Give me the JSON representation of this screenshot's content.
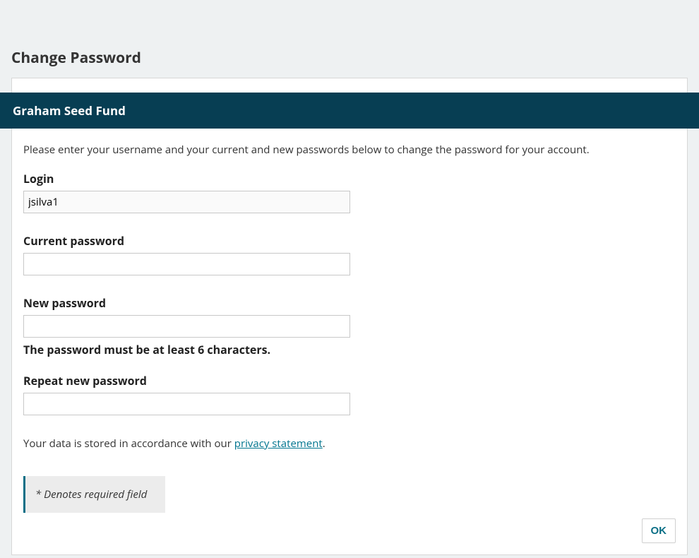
{
  "page": {
    "title": "Change Password"
  },
  "card": {
    "header": "Graham Seed Fund",
    "instructions": "Please enter your username and your current and new passwords below to change the password for your account."
  },
  "form": {
    "login": {
      "label": "Login",
      "value": "jsilva1"
    },
    "current_password": {
      "label": "Current password",
      "value": ""
    },
    "new_password": {
      "label": "New password",
      "value": "",
      "hint": "The password must be at least 6 characters."
    },
    "repeat_password": {
      "label": "Repeat new password",
      "value": ""
    }
  },
  "privacy": {
    "prefix": "Your data is stored in accordance with our ",
    "link_text": "privacy statement",
    "suffix": "."
  },
  "required_note": "* Denotes required field",
  "buttons": {
    "ok": "OK"
  }
}
